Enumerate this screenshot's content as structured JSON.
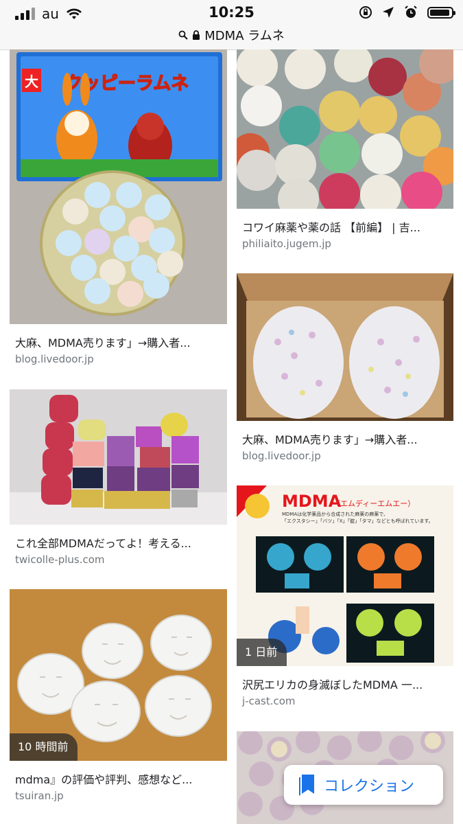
{
  "status_bar": {
    "carrier": "au",
    "time": "10:25"
  },
  "address_bar": {
    "query": "MDMA ラムネ"
  },
  "results": {
    "left": [
      {
        "title": "大麻、MDMA売ります」→購入者...",
        "domain": "blog.livedoor.jp"
      },
      {
        "title": "これ全部MDMAだってよ！考える...",
        "domain": "twicolle-plus.com"
      },
      {
        "title": "mdma』の評価や評判、感想など...",
        "domain": "tsuiran.jp",
        "badge": "10 時間前"
      }
    ],
    "right": [
      {
        "title": "コワイ麻薬や薬の話 【前編】 | 吉...",
        "domain": "philiaito.jugem.jp"
      },
      {
        "title": "大麻、MDMA売ります」→購入者...",
        "domain": "blog.livedoor.jp"
      },
      {
        "title": "沢尻エリカの身滅ぼしたMDMA 一...",
        "domain": "j-cast.com",
        "badge": "1 日前"
      }
    ]
  },
  "image_text": {
    "ramune_brand": "クッピーラムネ",
    "ramune_badge": "大",
    "mdma_heading": "MDMA",
    "mdma_subheading": "（エムディーエムエー）",
    "mdma_desc_1": "MDMAは化学薬品から合成された麻薬の麻薬で、",
    "mdma_desc_2": "「エクスタシー」「バツ」「X」「錠」「タマ」などとも呼ばれています。"
  },
  "fab": {
    "label": "コレクション"
  },
  "colors": {
    "accent": "#1a73e8",
    "domain_gray": "#70757a"
  }
}
